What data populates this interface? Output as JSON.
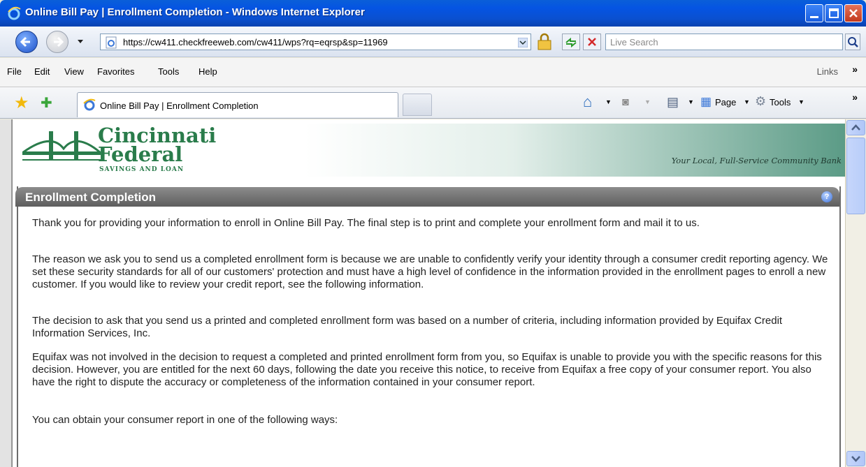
{
  "window": {
    "title": "Online Bill Pay | Enrollment Completion - Windows Internet Explorer"
  },
  "address": {
    "url": "https://cw411.checkfreeweb.com/cw411/wps?rq=eqrsp&sp=11969",
    "search_placeholder": "Live Search"
  },
  "menu": {
    "items": [
      "File",
      "Edit",
      "View",
      "Favorites",
      "Tools",
      "Help"
    ],
    "links": "Links"
  },
  "tabs": {
    "active": "Online Bill Pay | Enrollment Completion"
  },
  "commands": {
    "page": "Page",
    "tools": "Tools"
  },
  "bank": {
    "name_line1": "Cincinnati",
    "name_line2": "Federal",
    "subtitle": "SAVINGS AND LOAN",
    "tagline": "Your Local, Full-Service Community Bank"
  },
  "panel": {
    "title": "Enrollment Completion",
    "help": "?"
  },
  "content": {
    "p1": "Thank you for providing your information to enroll in Online Bill Pay. The final step is to print and complete your enrollment form and mail it to us.",
    "p2": "The reason we ask you to send us a completed enrollment form is because we are unable to confidently verify your identity through a consumer credit reporting agency. We set these security standards for all of our customers' protection and must have a high level of confidence in the information provided in the enrollment pages to enroll a new customer. If you would like to review your credit report, see the following information.",
    "p3": "The decision to ask that you send us a printed and completed enrollment form was based on a number of criteria, including information provided by Equifax Credit Information Services, Inc.",
    "p4": "Equifax was not involved in the decision to request a completed and printed enrollment form from you, so Equifax is unable to provide you with the specific reasons for this decision. However, you are entitled for the next 60 days, following the date you receive this notice, to receive from Equifax a free copy of your consumer report. You also have the right to dispute the accuracy or completeness of the information contained in your consumer report.",
    "p5": "You can obtain your consumer report in one of the following ways:"
  },
  "colors": {
    "titlebar": "#0554e3",
    "bank_green": "#2a7c4b",
    "panel_header": "#6e6e6e"
  }
}
